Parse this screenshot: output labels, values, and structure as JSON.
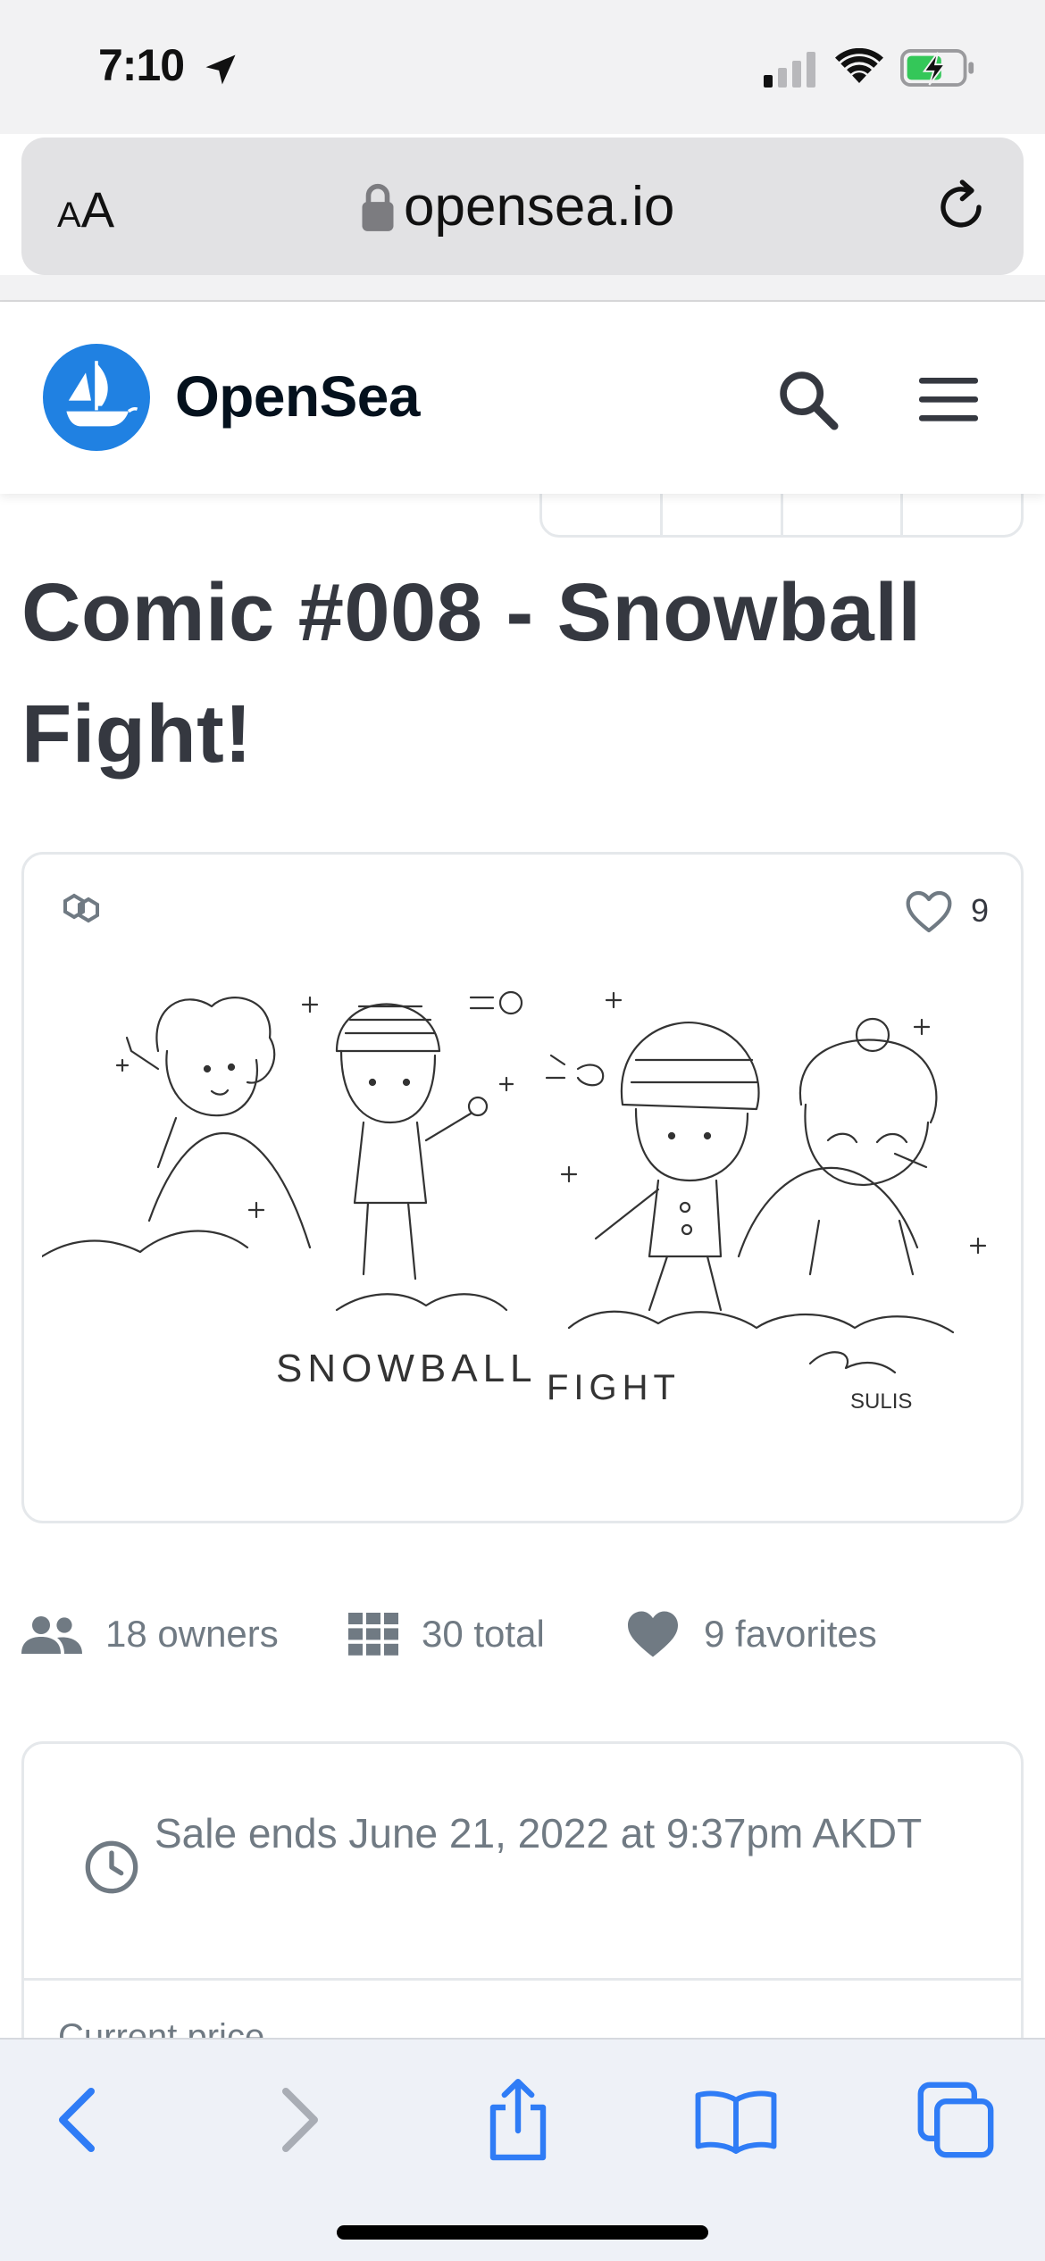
{
  "status_bar": {
    "time": "7:10",
    "icons": [
      "location-arrow-icon",
      "cellular-signal-icon",
      "wifi-icon",
      "battery-charging-icon"
    ]
  },
  "browser": {
    "text_size_label_small": "A",
    "text_size_label_large": "A",
    "url": "opensea.io",
    "icons": [
      "lock-icon",
      "reload-icon"
    ]
  },
  "site_header": {
    "brand_name": "OpenSea",
    "icons": [
      "opensea-logo-icon",
      "search-icon",
      "menu-icon"
    ]
  },
  "asset": {
    "title": "Comic #008 - Snowball Fight!",
    "favorite_count": "9",
    "artwork_caption": "SNOWBALL FIGHT",
    "artwork_signature": "SULIS",
    "icons": [
      "polygon-chain-icon",
      "heart-outline-icon"
    ]
  },
  "stats": {
    "owners": "18 owners",
    "total": "30 total",
    "favorites": "9 favorites",
    "icons": [
      "people-icon",
      "grid-icon",
      "heart-filled-icon"
    ]
  },
  "sale": {
    "ends_text": "Sale ends June 21, 2022 at 9:37pm AKDT",
    "price_label": "Current price",
    "icons": [
      "clock-icon"
    ]
  },
  "toolbar": {
    "icons": [
      "back-icon",
      "forward-icon",
      "share-icon",
      "bookmarks-icon",
      "tabs-icon"
    ]
  },
  "colors": {
    "brand_blue": "#2081e2",
    "ios_blue": "#2f7cf6",
    "text_primary": "#353840",
    "text_secondary": "#707a83",
    "border": "#e5e8eb"
  }
}
